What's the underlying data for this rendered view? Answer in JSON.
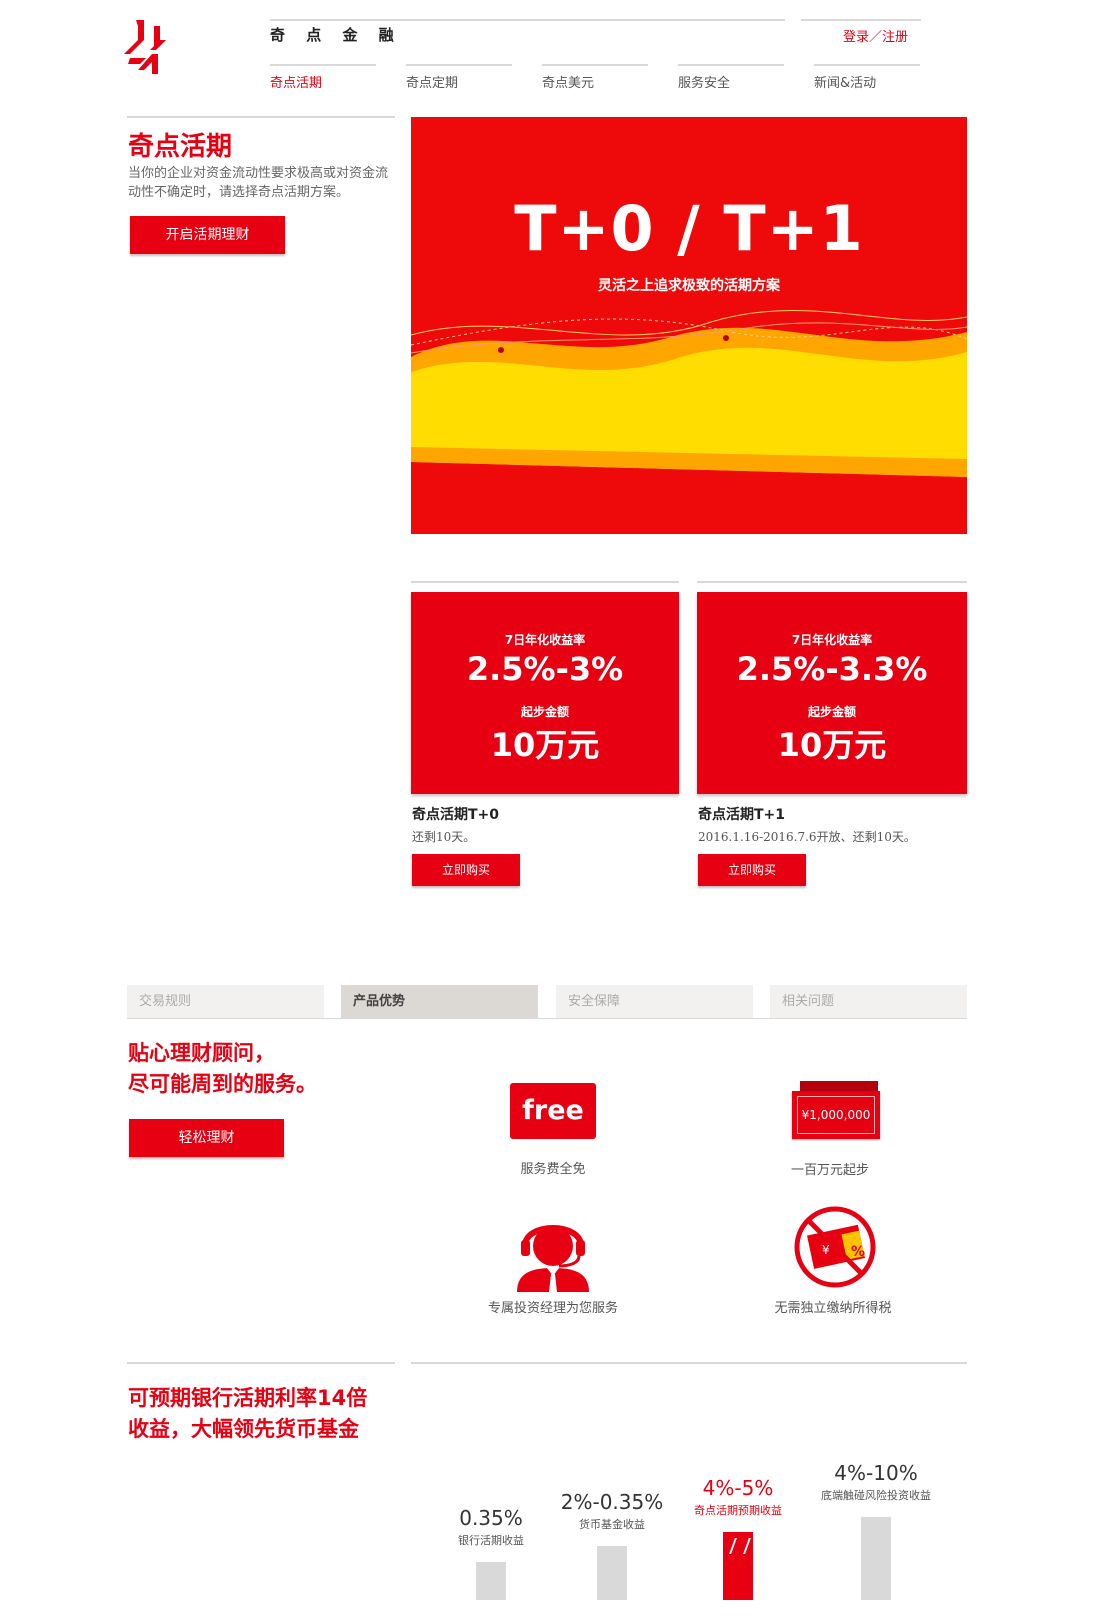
{
  "header": {
    "brand": "奇 点 金 融",
    "login": "登录／注册",
    "nav": [
      {
        "label": "奇点活期",
        "active": true
      },
      {
        "label": "奇点定期",
        "active": false
      },
      {
        "label": "奇点美元",
        "active": false
      },
      {
        "label": "服务安全",
        "active": false
      },
      {
        "label": "新闻&活动",
        "active": false
      }
    ]
  },
  "intro": {
    "title": "奇点活期",
    "description": "当你的企业对资金流动性要求极高或对资金流动性不确定时，请选择奇点活期方案。",
    "button": "开启活期理财"
  },
  "hero": {
    "title": "T+0 / T+1",
    "subtitle": "灵活之上追求极致的活期方案"
  },
  "products": [
    {
      "rate_label": "7日年化收益率",
      "rate": "2.5%-3%",
      "min_label": "起步金额",
      "min": "10万元",
      "name": "奇点活期T+0",
      "desc": "还剩10天。",
      "button": "立即购买"
    },
    {
      "rate_label": "7日年化收益率",
      "rate": "2.5%-3.3%",
      "min_label": "起步金额",
      "min": "10万元",
      "name": "奇点活期T+1",
      "desc": "2016.1.16-2016.7.6开放、还剩10天。",
      "button": "立即购买"
    }
  ],
  "tabs": [
    {
      "label": "交易规则",
      "active": false
    },
    {
      "label": "产品优势",
      "active": true
    },
    {
      "label": "安全保障",
      "active": false
    },
    {
      "label": "相关问题",
      "active": false
    }
  ],
  "advantage": {
    "title_line1": "贴心理财顾问，",
    "title_line2": "尽可能周到的服务。",
    "button": "轻松理财",
    "features": [
      {
        "icon": "free-icon",
        "icon_text": "free",
        "label": "服务费全免"
      },
      {
        "icon": "cash-icon",
        "icon_text": "¥1,000,000",
        "label": "一百万元起步"
      },
      {
        "icon": "manager-icon",
        "label": "专属投资经理为您服务"
      },
      {
        "icon": "no-tax-icon",
        "label": "无需独立缴纳所得税"
      }
    ]
  },
  "comparison": {
    "title_line1": "可预期银行活期利率14倍",
    "title_line2": "收益，大幅领先货币基金"
  },
  "chart_data": {
    "type": "bar",
    "categories": [
      "银行活期收益",
      "货币基金收益",
      "奇点活期预期收益",
      "底端触碰风险投资收益"
    ],
    "value_labels": [
      "0.35%",
      "2%-0.35%",
      "4%-5%",
      "4%-10%"
    ],
    "values": [
      0.35,
      2,
      5,
      10
    ],
    "highlight_index": 2,
    "colors": {
      "default": "#d9d9d9",
      "highlight": "#e60012"
    }
  },
  "colors": {
    "brand_red": "#e60012",
    "hero_yellow": "#ffdd00",
    "hero_orange": "#ffa500"
  }
}
